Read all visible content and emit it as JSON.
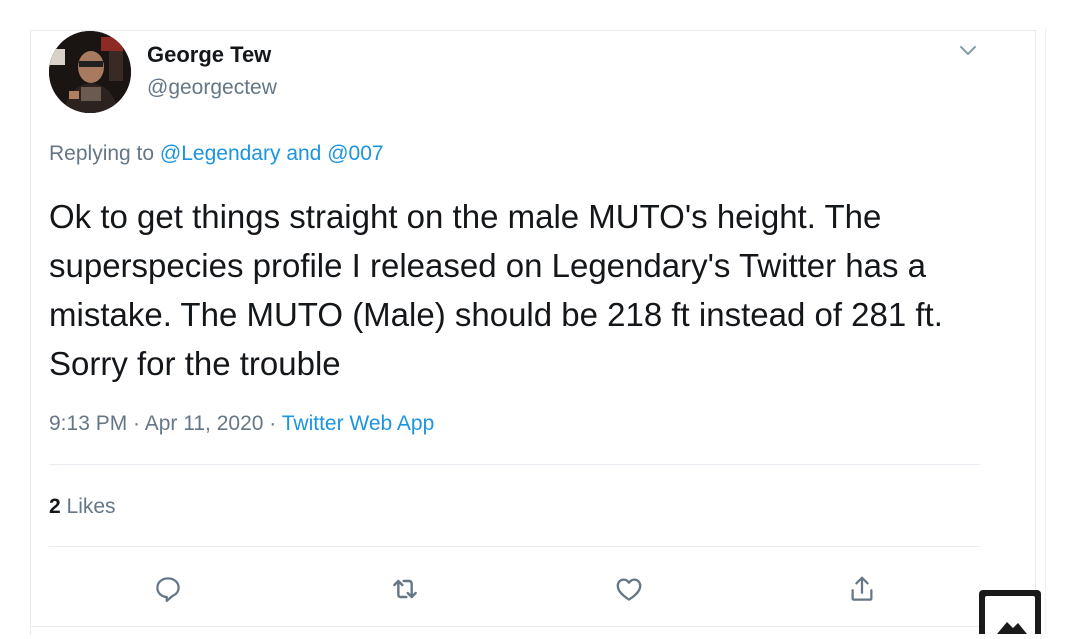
{
  "tweet": {
    "author_name": "George Tew",
    "author_handle": "@georgectew",
    "replying_prefix": "Replying to ",
    "replying_mention_1": "@Legendary",
    "replying_and": " and ",
    "replying_mention_2": "@007",
    "text": "Ok to get things straight on the male MUTO's height. The superspecies profile I released on Legendary's Twitter has a mistake. The MUTO (Male) should be 218 ft instead of 281 ft. Sorry for the trouble",
    "time": "9:13 PM",
    "separator_1": " · ",
    "date": "Apr 11, 2020",
    "separator_2": " · ",
    "source_app": "Twitter Web App",
    "likes_count": "2",
    "likes_label": " Likes"
  },
  "icons": {
    "more": "chevron-down-icon",
    "reply": "reply-icon",
    "retweet": "retweet-icon",
    "like": "heart-icon",
    "share": "share-icon",
    "image_overlay": "image-icon"
  },
  "colors": {
    "text_primary": "#14171a",
    "text_secondary": "#657786",
    "link": "#1b95e0",
    "divider": "#e6ecf0"
  }
}
